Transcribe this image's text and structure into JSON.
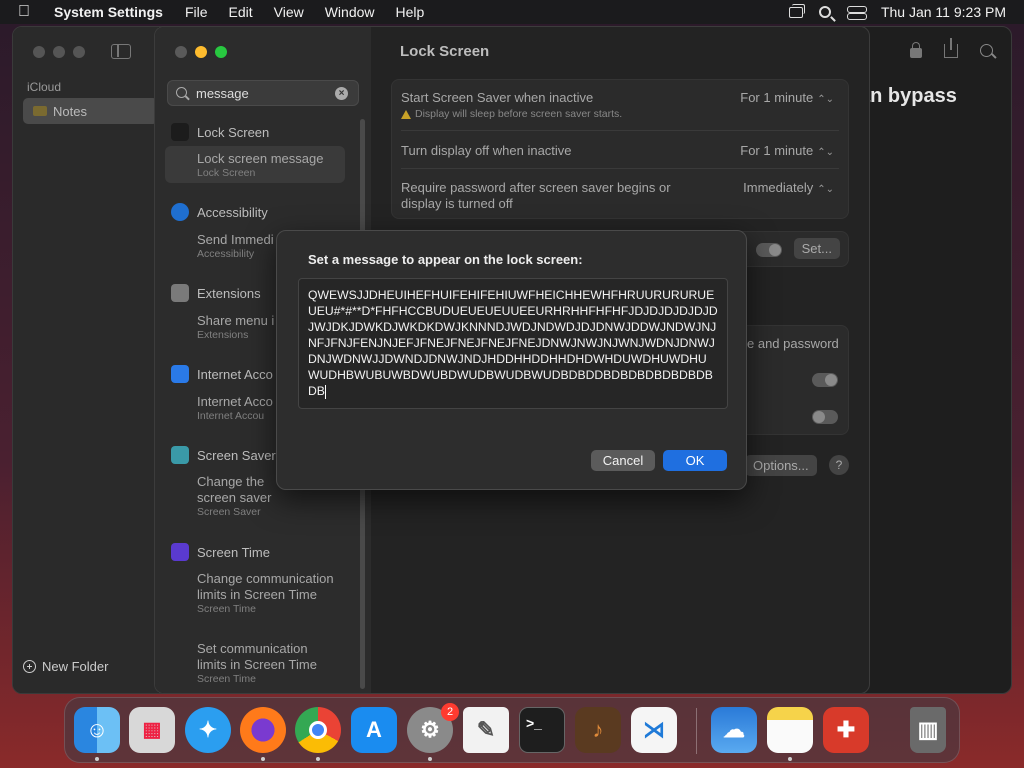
{
  "menubar": {
    "app_name": "System Settings",
    "menus": [
      "File",
      "Edit",
      "View",
      "Window",
      "Help"
    ],
    "clock": "Thu Jan 11  9:23 PM"
  },
  "notes_window": {
    "section_label": "iCloud",
    "folder": "Notes",
    "new_folder": "New Folder",
    "note_fragment": "an bypass"
  },
  "settings": {
    "search_value": "message",
    "sidebar": [
      {
        "section": "Lock Screen",
        "items": [
          {
            "title": "Lock screen message",
            "subtitle": "Lock Screen"
          }
        ]
      },
      {
        "section": "Accessibility",
        "items": [
          {
            "title": "Send Immedi",
            "subtitle": "Accessibility"
          }
        ]
      },
      {
        "section": "Extensions",
        "items": [
          {
            "title": "Share menu i",
            "subtitle": "Extensions"
          }
        ]
      },
      {
        "section": "Internet Acco",
        "items": [
          {
            "title": "Internet Acco",
            "subtitle": "Internet Accou"
          }
        ]
      },
      {
        "section": "Screen Saver",
        "items": [
          {
            "title": "Change the screen saver",
            "subtitle": "Screen Saver"
          }
        ]
      },
      {
        "section": "Screen Time",
        "items": [
          {
            "title": "Change communication limits in Screen Time",
            "subtitle": "Screen Time"
          },
          {
            "title": "Set communication limits in Screen Time",
            "subtitle": "Screen Time"
          }
        ]
      }
    ],
    "main_title": "Lock Screen",
    "rows": [
      {
        "label": "Start Screen Saver when inactive",
        "value": "For 1 minute",
        "warning": "Display will sleep before screen saver starts."
      },
      {
        "label": "Turn display off when inactive",
        "value": "For 1 minute"
      },
      {
        "label": "Require password after screen saver begins or display is turned off",
        "value": "Immediately"
      }
    ],
    "set_button": "Set...",
    "partial_label": "e and password",
    "options_button": "Options...",
    "help_button": "?"
  },
  "dialog": {
    "title": "Set a message to appear on the lock screen:",
    "message": "QWEWSJJDHEUIHEFHUIFEHIFEHIUWFHEICHHEWHFHRUURURURUEUEU#*#**D*FHFHCCBUDUEUEUEUUEEURHRHHFHFHFJDJDJDJDJDJDJWJDKJDWKDJWKDKDWJKNNNDJWDJNDWDJDJDNWJDDWJNDWJNJNFJFNJFENJNJEFJFNEJFNEJFNEJFNEJDNWJNWJNJWNJWDNJDNWJDNJWDNWJJDWNDJDNWJNDJHDDHHDDHHDHDWHDUWDHUWDHUWUDHBWUBUWBDWUBDWUDBWUDBWUDBDBDDBDBDBDBDBDBDBDB",
    "cancel_label": "Cancel",
    "ok_label": "OK"
  },
  "dock": {
    "apps": [
      {
        "name": "finder",
        "color": "#3a8ee6"
      },
      {
        "name": "launchpad",
        "color": "#d8d8d8"
      },
      {
        "name": "safari",
        "color": "#2b9ef0"
      },
      {
        "name": "firefox",
        "color": "#ff7a1a"
      },
      {
        "name": "chrome",
        "color": "#e8e8e8"
      },
      {
        "name": "app-store",
        "color": "#1a8cf0"
      },
      {
        "name": "system-settings",
        "color": "#8a8a8a"
      },
      {
        "name": "textedit",
        "color": "#f2f2f2"
      },
      {
        "name": "terminal",
        "color": "#1e1e1e"
      },
      {
        "name": "garageband",
        "color": "#e07a2a"
      },
      {
        "name": "vscode",
        "color": "#f5f5f5"
      },
      {
        "name": "weather",
        "color": "#3a8ae0"
      },
      {
        "name": "notes",
        "color": "#f6d34a"
      },
      {
        "name": "instruments",
        "color": "#d83a2a"
      },
      {
        "name": "trash",
        "color": "#6a6a6a"
      }
    ],
    "settings_badge": "2"
  }
}
